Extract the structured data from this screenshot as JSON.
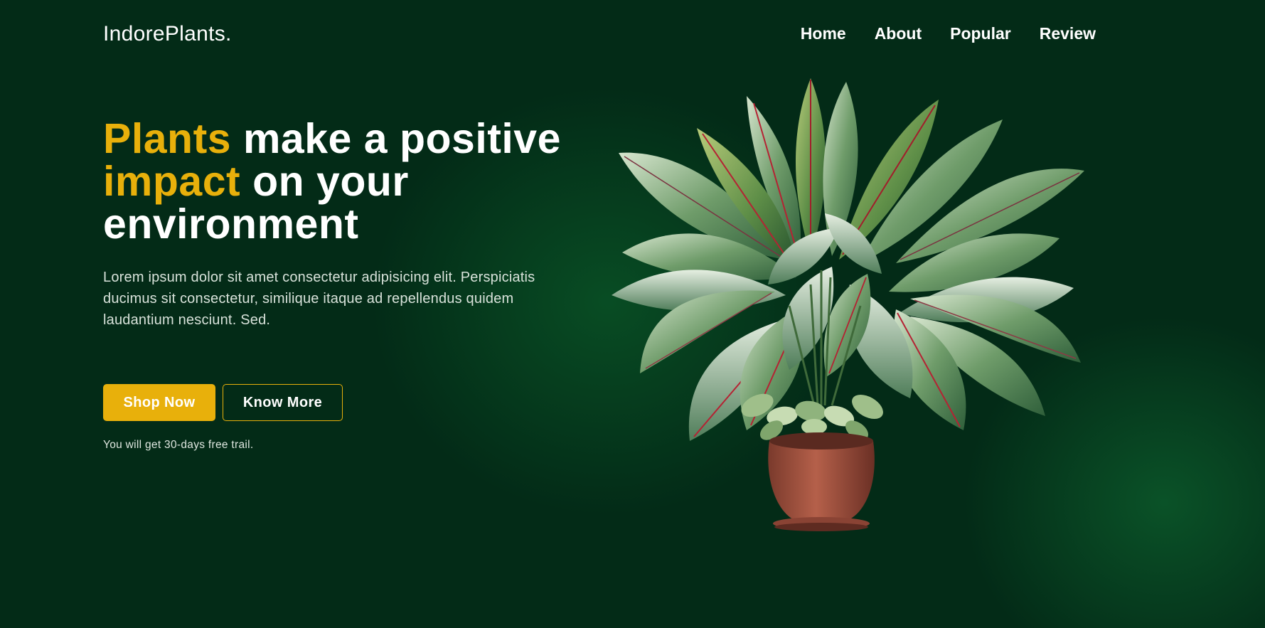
{
  "nav": {
    "logo": "IndorePlants.",
    "links": [
      "Home",
      "About",
      "Popular",
      "Review"
    ]
  },
  "hero": {
    "title_parts": [
      "Plants",
      " make a positive ",
      "impact",
      " on your environment"
    ],
    "description": "Lorem ipsum dolor sit amet consectetur adipisicing elit. Perspiciatis ducimus sit consectetur, similique itaque ad repellendus quidem laudantium nesciunt. Sed.",
    "primary_button": "Shop Now",
    "secondary_button": "Know More",
    "trial_note": "You will get 30-days free trail."
  },
  "colors": {
    "background": "#032b17",
    "accent": "#e8b00b",
    "text": "#ffffff"
  },
  "icons": {
    "hero_image": "potted-plant-image"
  }
}
